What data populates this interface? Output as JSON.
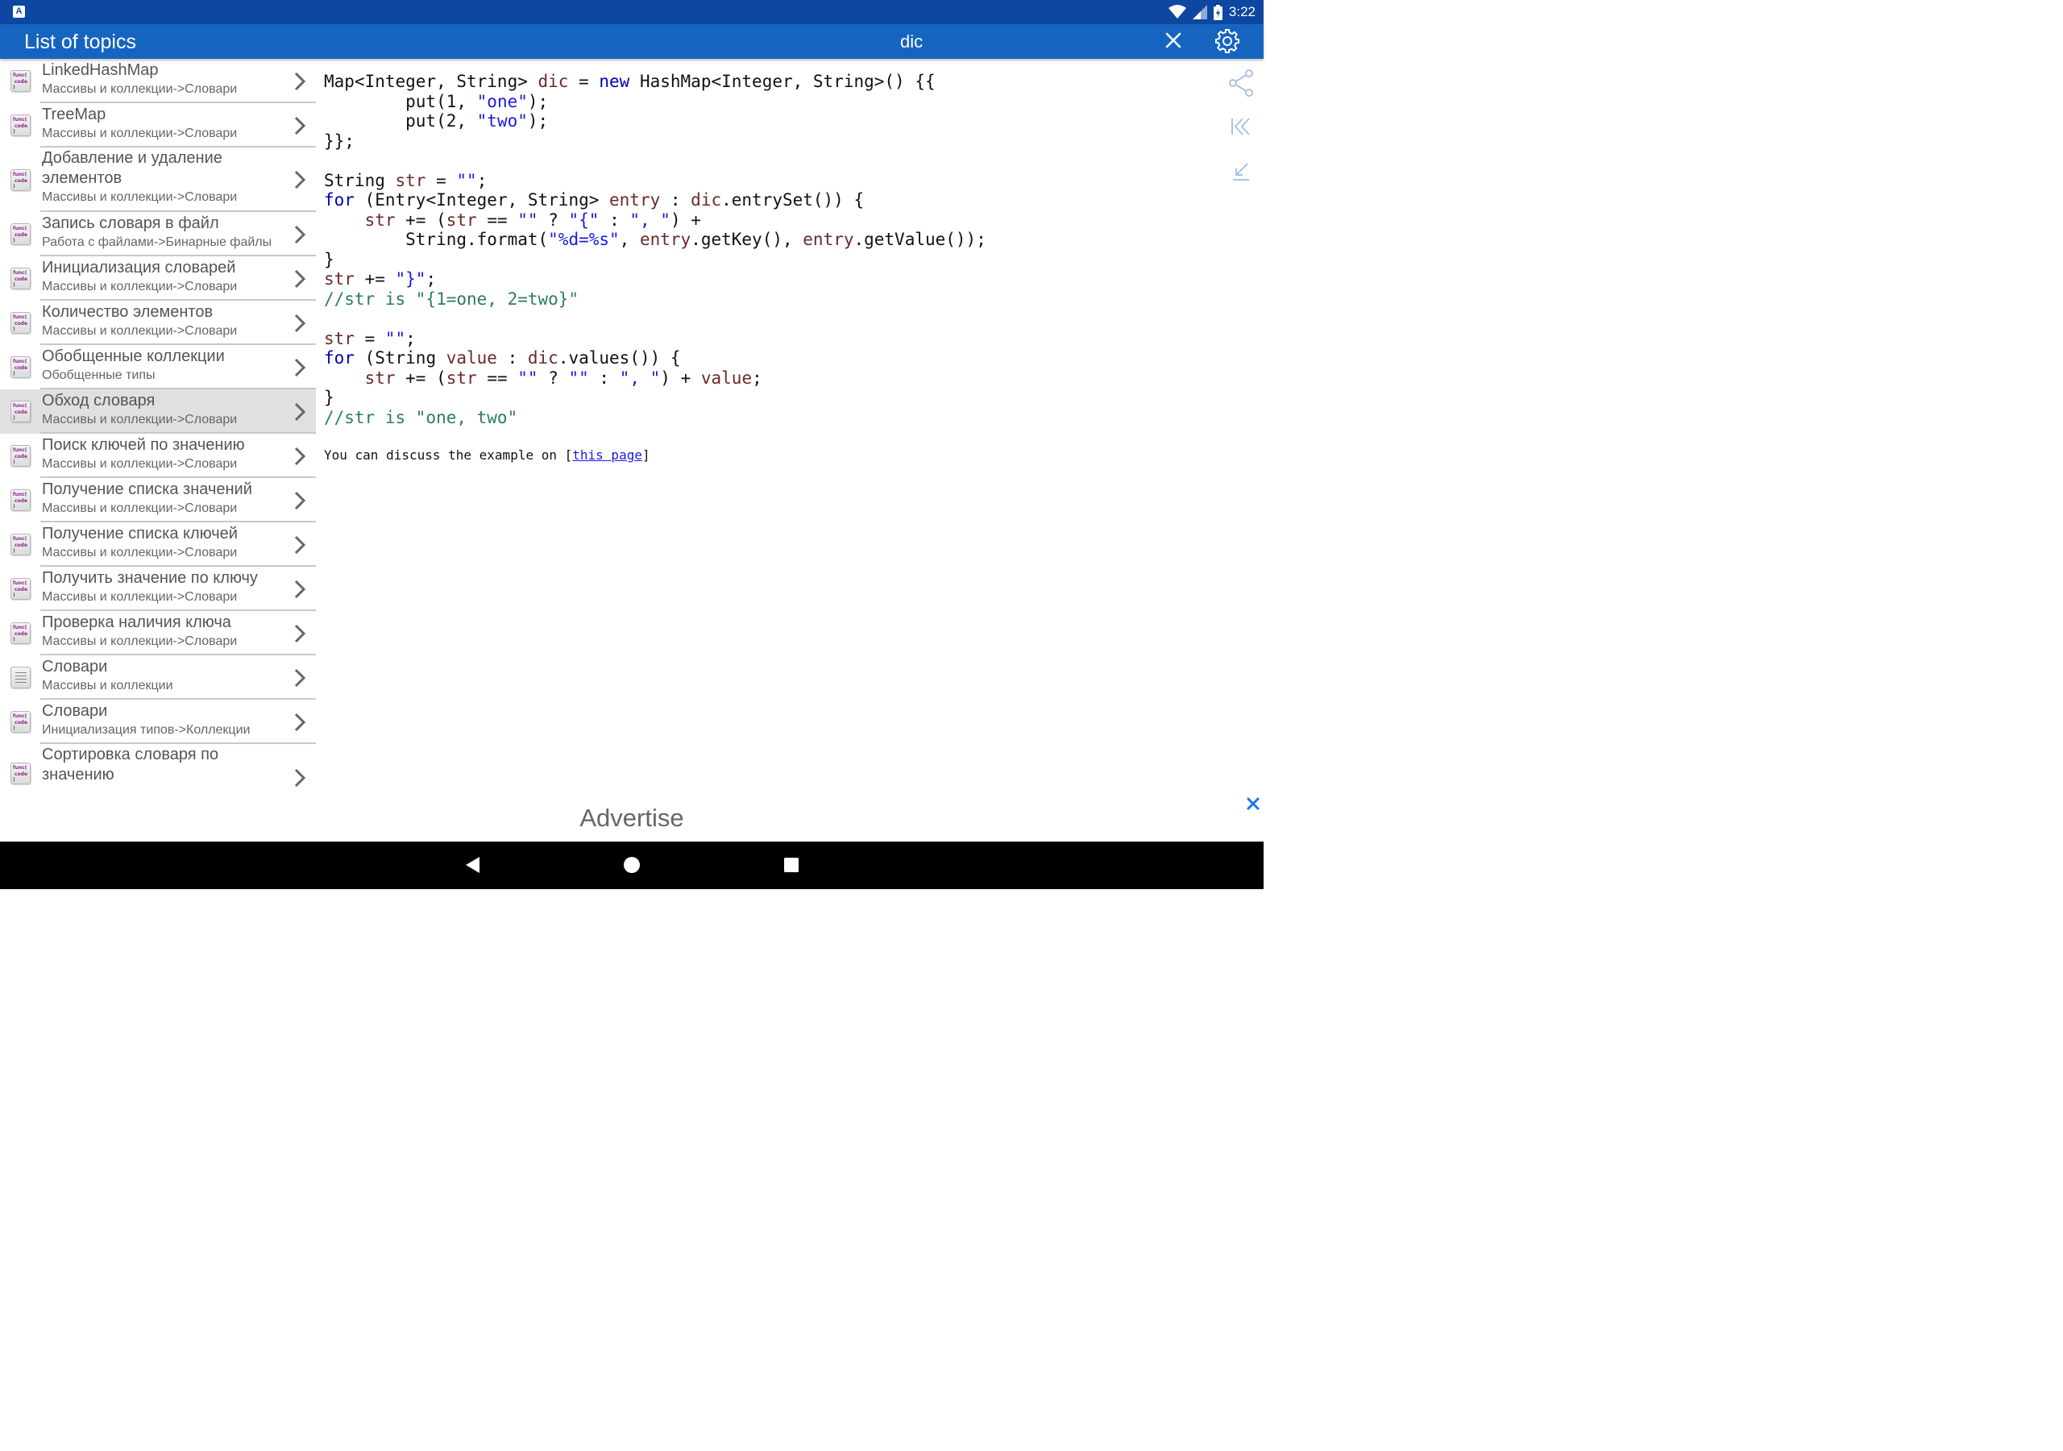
{
  "status_bar": {
    "time": "3:22",
    "app_icon": "A"
  },
  "app_bar": {
    "title": "List of topics",
    "search_text": "dic"
  },
  "topics": [
    {
      "title": "LinkedHashMap",
      "subtitle": "Массивы и коллекции->Словари",
      "icon": "code-icon"
    },
    {
      "title": "TreeMap",
      "subtitle": "Массивы и коллекции->Словари",
      "icon": "code-icon"
    },
    {
      "title": "Добавление и удаление элементов",
      "subtitle": "Массивы и коллекции->Словари",
      "icon": "code-icon"
    },
    {
      "title": "Запись словаря в файл",
      "subtitle": "Работа с файлами->Бинарные файлы",
      "icon": "code-icon"
    },
    {
      "title": "Инициализация словарей",
      "subtitle": "Массивы и коллекции->Словари",
      "icon": "code-icon"
    },
    {
      "title": "Количество элементов",
      "subtitle": "Массивы и коллекции->Словари",
      "icon": "code-icon"
    },
    {
      "title": "Обобщенные коллекции",
      "subtitle": "Обобщенные типы",
      "icon": "code-icon"
    },
    {
      "title": "Обход словаря",
      "subtitle": "Массивы и коллекции->Словари",
      "icon": "code-icon",
      "selected": true
    },
    {
      "title": "Поиск ключей по значению",
      "subtitle": "Массивы и коллекции->Словари",
      "icon": "code-icon"
    },
    {
      "title": "Получение списка значений",
      "subtitle": "Массивы и коллекции->Словари",
      "icon": "code-icon"
    },
    {
      "title": "Получение списка ключей",
      "subtitle": "Массивы и коллекции->Словари",
      "icon": "code-icon"
    },
    {
      "title": "Получить значение по ключу",
      "subtitle": "Массивы и коллекции->Словари",
      "icon": "code-icon"
    },
    {
      "title": "Проверка наличия ключа",
      "subtitle": "Массивы и коллекции->Словари",
      "icon": "code-icon"
    },
    {
      "title": "Словари",
      "subtitle": "Массивы и коллекции",
      "icon": "list-icon"
    },
    {
      "title": "Словари",
      "subtitle": "Инициализация типов->Коллекции",
      "icon": "code-icon"
    },
    {
      "title": "Сортировка словаря по значению",
      "subtitle": "",
      "icon": "code-icon"
    }
  ],
  "icon_text": {
    "line1": "func(",
    "line2": "code",
    "line3": ")"
  },
  "code_lines": [
    [
      [
        "t",
        "Map<Integer, String> "
      ],
      [
        "v",
        "dic"
      ],
      [
        "t",
        " = "
      ],
      [
        "k",
        "new"
      ],
      [
        "t",
        " HashMap<Integer, String>() {{"
      ]
    ],
    [
      [
        "t",
        "        put(1, "
      ],
      [
        "s",
        "\"one\""
      ],
      [
        "t",
        ");"
      ]
    ],
    [
      [
        "t",
        "        put(2, "
      ],
      [
        "s",
        "\"two\""
      ],
      [
        "t",
        ");"
      ]
    ],
    [
      [
        "t",
        "}};"
      ]
    ],
    [
      [
        "t",
        ""
      ]
    ],
    [
      [
        "t",
        "String "
      ],
      [
        "v",
        "str"
      ],
      [
        "t",
        " = "
      ],
      [
        "s",
        "\"\""
      ],
      [
        "t",
        ";"
      ]
    ],
    [
      [
        "k",
        "for"
      ],
      [
        "t",
        " (Entry<Integer, String> "
      ],
      [
        "v",
        "entry"
      ],
      [
        "t",
        " : "
      ],
      [
        "v",
        "dic"
      ],
      [
        "t",
        ".entrySet()) {"
      ]
    ],
    [
      [
        "t",
        "    "
      ],
      [
        "v",
        "str"
      ],
      [
        "t",
        " += ("
      ],
      [
        "v",
        "str"
      ],
      [
        "t",
        " == "
      ],
      [
        "s",
        "\"\""
      ],
      [
        "t",
        " ? "
      ],
      [
        "s",
        "\"{\""
      ],
      [
        "t",
        " : "
      ],
      [
        "s",
        "\", \""
      ],
      [
        "t",
        ") +"
      ]
    ],
    [
      [
        "t",
        "        String.format("
      ],
      [
        "s",
        "\"%d=%s\""
      ],
      [
        "t",
        ", "
      ],
      [
        "v",
        "entry"
      ],
      [
        "t",
        ".getKey(), "
      ],
      [
        "v",
        "entry"
      ],
      [
        "t",
        ".getValue());"
      ]
    ],
    [
      [
        "t",
        "}"
      ]
    ],
    [
      [
        "v",
        "str"
      ],
      [
        "t",
        " += "
      ],
      [
        "s",
        "\"}\""
      ],
      [
        "t",
        ";"
      ]
    ],
    [
      [
        "c",
        "//str is \"{1=one, 2=two}\""
      ]
    ],
    [
      [
        "t",
        ""
      ]
    ],
    [
      [
        "v",
        "str"
      ],
      [
        "t",
        " = "
      ],
      [
        "s",
        "\"\""
      ],
      [
        "t",
        ";"
      ]
    ],
    [
      [
        "k",
        "for"
      ],
      [
        "t",
        " (String "
      ],
      [
        "v",
        "value"
      ],
      [
        "t",
        " : "
      ],
      [
        "v",
        "dic"
      ],
      [
        "t",
        ".values()) {"
      ]
    ],
    [
      [
        "t",
        "    "
      ],
      [
        "v",
        "str"
      ],
      [
        "t",
        " += ("
      ],
      [
        "v",
        "str"
      ],
      [
        "t",
        " == "
      ],
      [
        "s",
        "\"\""
      ],
      [
        "t",
        " ? "
      ],
      [
        "s",
        "\"\""
      ],
      [
        "t",
        " : "
      ],
      [
        "s",
        "\", \""
      ],
      [
        "t",
        ") + "
      ],
      [
        "v",
        "value"
      ],
      [
        "t",
        ";"
      ]
    ],
    [
      [
        "t",
        "}"
      ]
    ],
    [
      [
        "c",
        "//str is \"one, two\""
      ]
    ]
  ],
  "discussion": {
    "prefix": "You can discuss the example on ",
    "bracket_open": "[",
    "link_text": "this page",
    "bracket_close": "]"
  },
  "side_tools": [
    "share-icon",
    "collapse-left-icon",
    "minimize-icon"
  ],
  "advert": {
    "label": "Advertise"
  },
  "colors": {
    "status_bar": "#0d47a1",
    "app_bar": "#1565c0",
    "selected_row": "#e0e0e0",
    "keyword": "#0000c0",
    "string": "#1a1ae6",
    "variable": "#6b2a2a",
    "comment": "#2e7d5b"
  }
}
